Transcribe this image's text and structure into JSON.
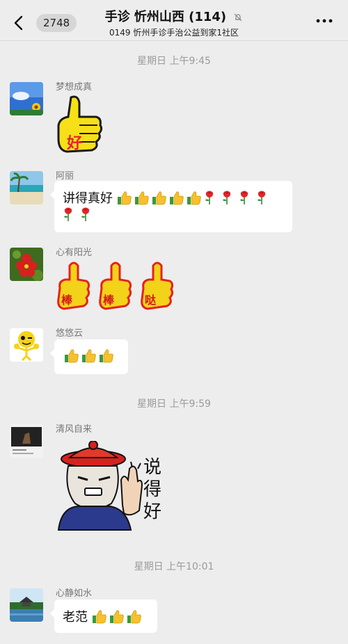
{
  "header": {
    "back_count": "2748",
    "title": "手诊 忻州山西 (114)",
    "subtitle": "0149 忻州手诊手治公益到家1社区"
  },
  "times": [
    "星期日 上午9:45",
    "星期日 上午9:59",
    "星期日 上午10:01"
  ],
  "messages": [
    {
      "sender": "梦想成真",
      "sticker_text": "好"
    },
    {
      "sender": "阿丽",
      "text": "讲得真好"
    },
    {
      "sender": "心有阳光",
      "sticker_texts": [
        "棒",
        "棒",
        "哒"
      ]
    },
    {
      "sender": "悠悠云"
    },
    {
      "sender": "清风自来",
      "sticker_text": "说得好"
    },
    {
      "sender": "心静如水",
      "text": "老范"
    }
  ],
  "colors": {
    "background": "#ededed",
    "bubble": "#ffffff",
    "sender": "#777777",
    "time": "#9a9a9a"
  },
  "icons": [
    "back-chevron-icon",
    "mute-bell-icon",
    "more-dots-icon",
    "thumbs-up-emoji",
    "rose-emoji"
  ]
}
